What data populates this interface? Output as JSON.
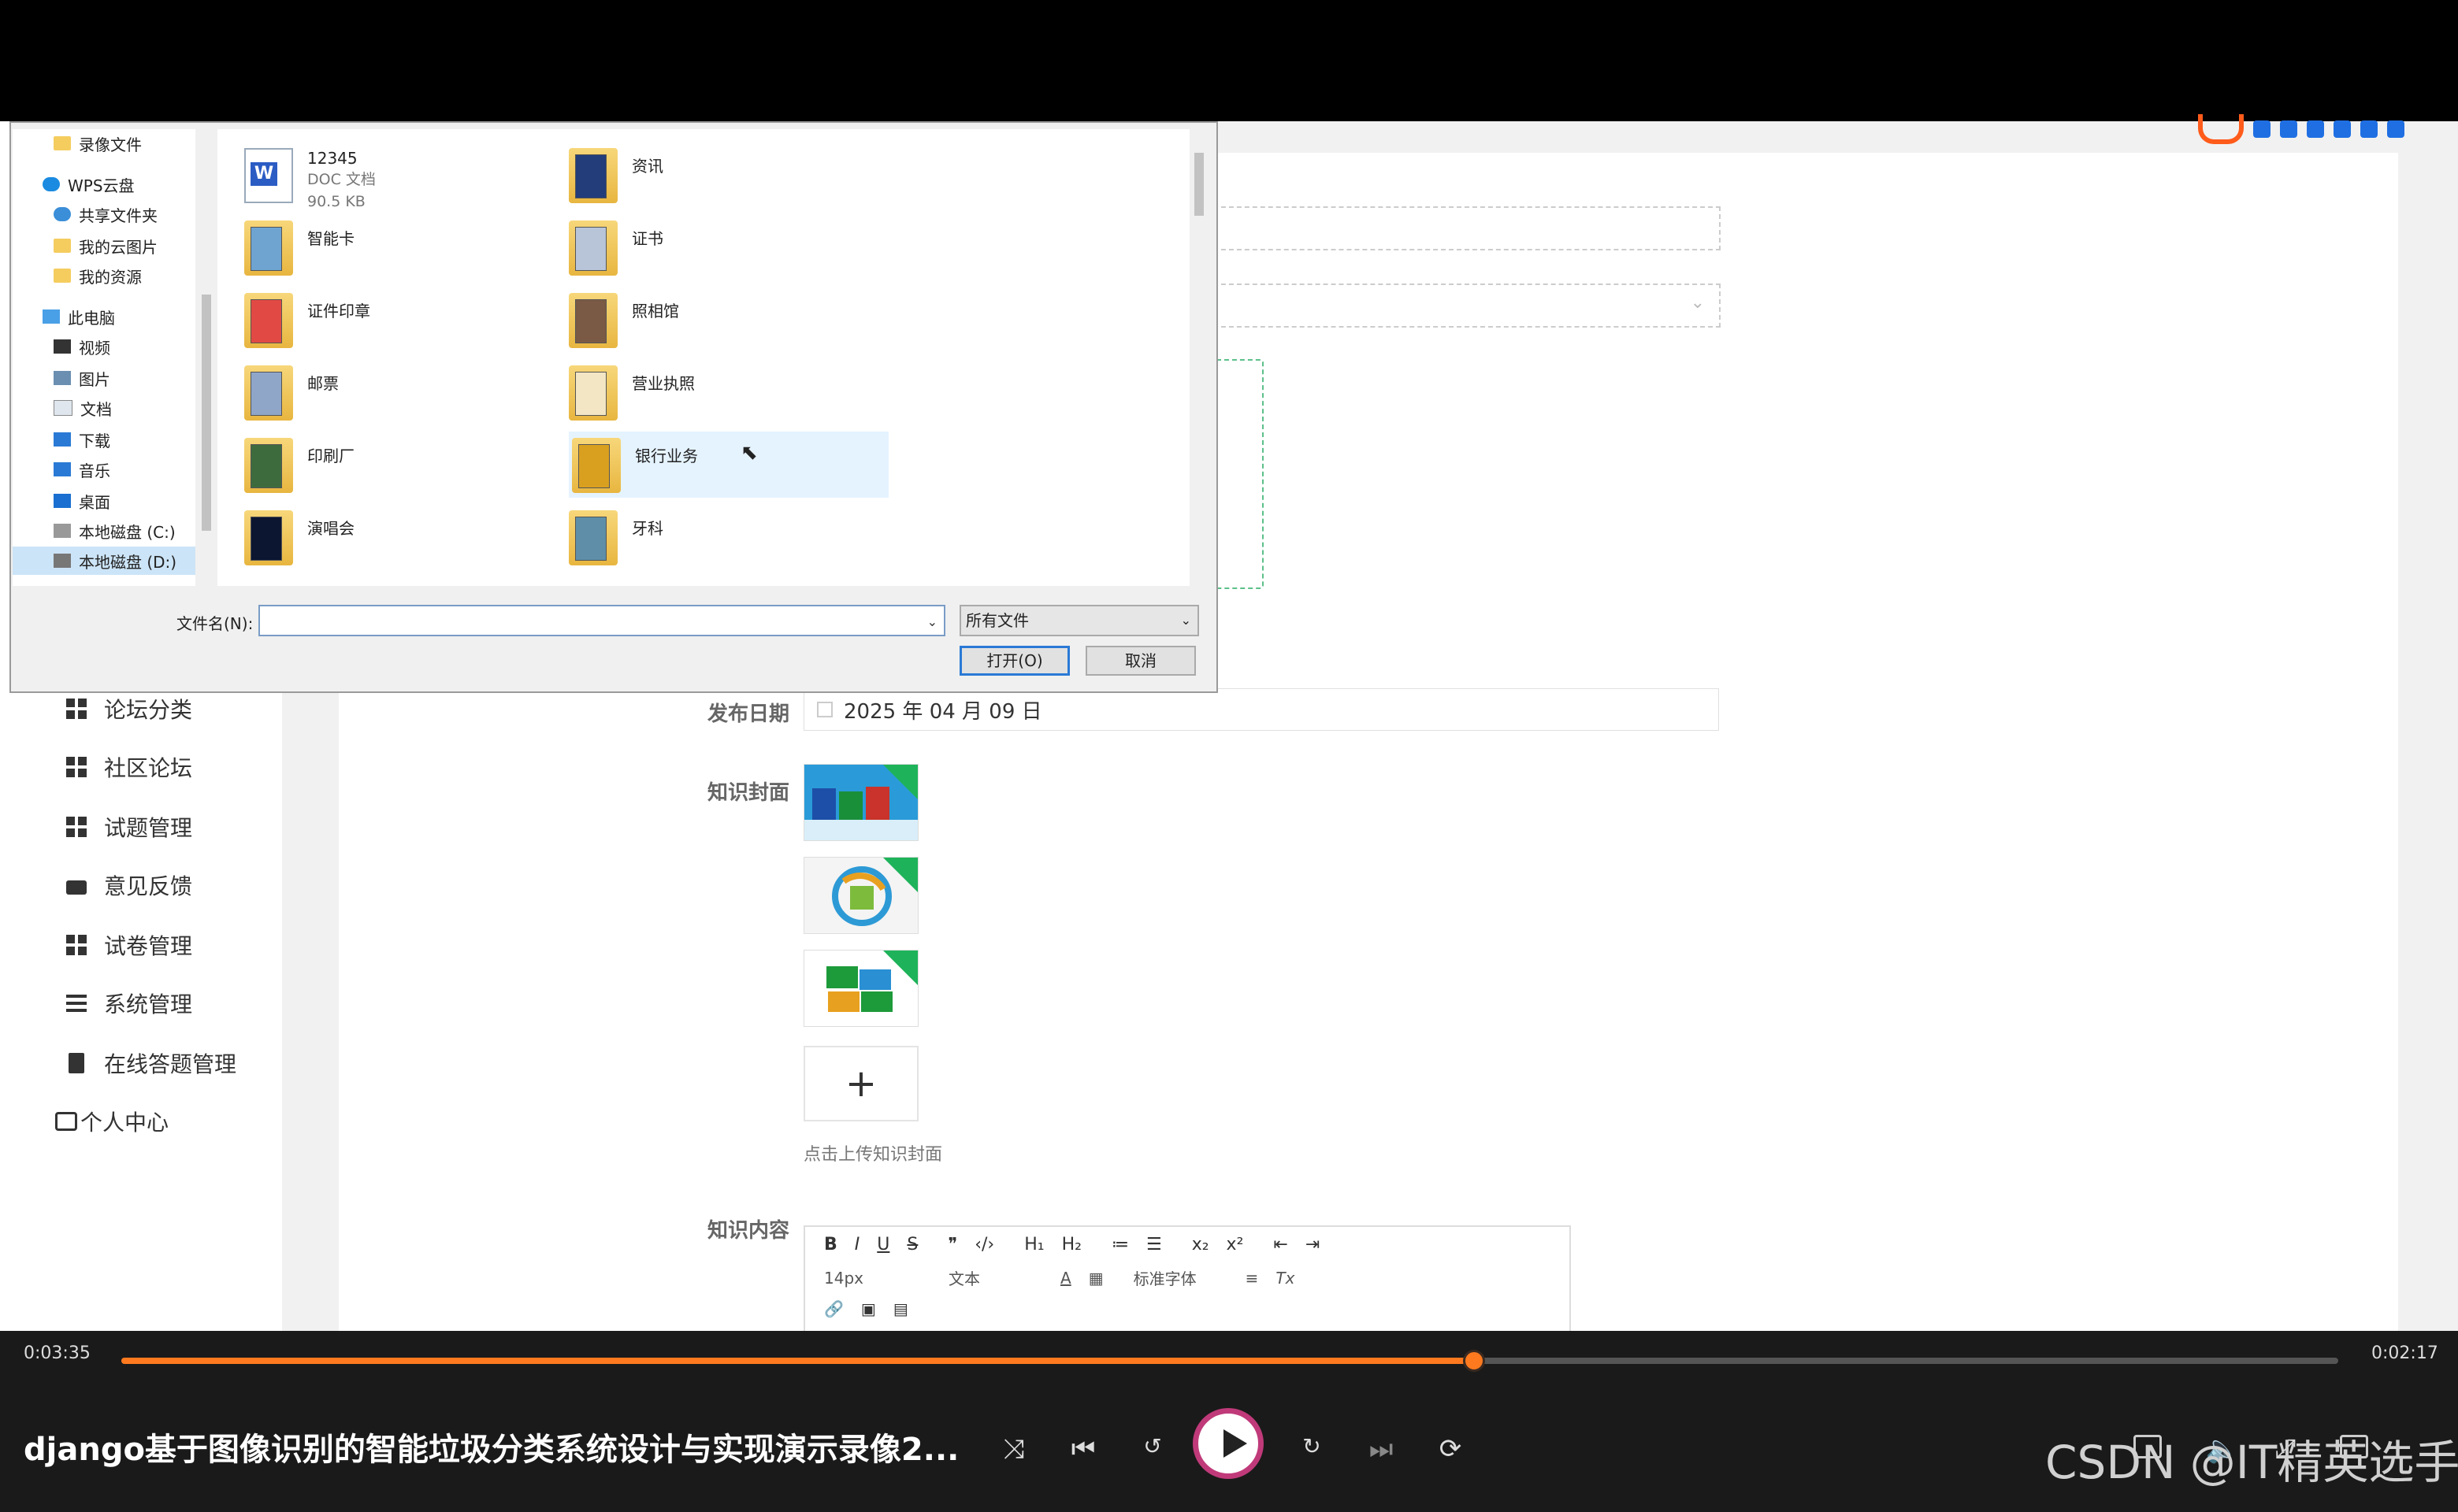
{
  "dialog": {
    "tree": [
      {
        "label": "录像文件",
        "icon": "folder-icon"
      },
      {
        "label": "WPS云盘",
        "icon": "cloud-icon"
      },
      {
        "label": "共享文件夹",
        "icon": "share-icon"
      },
      {
        "label": "我的云图片",
        "icon": "folder-icon"
      },
      {
        "label": "我的资源",
        "icon": "folder-icon"
      },
      {
        "label": "此电脑",
        "icon": "computer-icon"
      },
      {
        "label": "视频",
        "icon": "video-icon"
      },
      {
        "label": "图片",
        "icon": "picture-icon"
      },
      {
        "label": "文档",
        "icon": "document-icon"
      },
      {
        "label": "下载",
        "icon": "download-icon"
      },
      {
        "label": "音乐",
        "icon": "music-icon"
      },
      {
        "label": "桌面",
        "icon": "desktop-icon"
      },
      {
        "label": "本地磁盘 (C:)",
        "icon": "drive-icon"
      },
      {
        "label": "本地磁盘 (D:)",
        "icon": "drive-icon"
      }
    ],
    "files": [
      {
        "name": "12345",
        "type": "DOC 文档",
        "size": "90.5 KB",
        "icon": "word-doc-icon"
      },
      {
        "name": "资讯",
        "icon": "folder-icon"
      },
      {
        "name": "智能卡",
        "icon": "folder-icon"
      },
      {
        "name": "证书",
        "icon": "folder-icon"
      },
      {
        "name": "证件印章",
        "icon": "folder-icon"
      },
      {
        "name": "照相馆",
        "icon": "folder-icon"
      },
      {
        "name": "邮票",
        "icon": "folder-icon"
      },
      {
        "name": "营业执照",
        "icon": "folder-icon"
      },
      {
        "name": "印刷厂",
        "icon": "folder-icon"
      },
      {
        "name": "银行业务",
        "icon": "folder-icon"
      },
      {
        "name": "演唱会",
        "icon": "folder-icon"
      },
      {
        "name": "牙科",
        "icon": "folder-icon"
      }
    ],
    "filename_label": "文件名(N):",
    "filename_value": "",
    "filetype": "所有文件",
    "open_button": "打开(O)",
    "cancel_button": "取消"
  },
  "sidebar": {
    "items": [
      {
        "label": "论坛分类",
        "icon": "grid-icon"
      },
      {
        "label": "社区论坛",
        "icon": "grid-icon"
      },
      {
        "label": "试题管理",
        "icon": "grid-icon"
      },
      {
        "label": "意见反馈",
        "icon": "briefcase-icon"
      },
      {
        "label": "试卷管理",
        "icon": "grid-icon"
      },
      {
        "label": "系统管理",
        "icon": "list-icon"
      },
      {
        "label": "在线答题管理",
        "icon": "clipboard-icon"
      },
      {
        "label": "个人中心",
        "icon": "user-card-icon"
      }
    ]
  },
  "form": {
    "date_label": "发布日期",
    "date_value": "2025 年 04 月 09 日",
    "cover_label": "知识封面",
    "upload_plus": "+",
    "upload_hint": "点击上传知识封面",
    "content_label": "知识内容",
    "editor_toolbar": {
      "bold": "B",
      "italic": "I",
      "underline": "U",
      "strike": "S",
      "quote": "❞",
      "code": "‹/›",
      "h1": "H₁",
      "h2": "H₂",
      "ordered_list": "≔",
      "bullet_list": "☰",
      "subscript": "x₂",
      "superscript": "x²",
      "outdent": "⇤",
      "indent": "⇥",
      "font_size": "14px",
      "block_type": "文本",
      "font_color": "A",
      "background_color": "▦",
      "font_family": "标准字体",
      "align": "≡",
      "clear_format": "Tx",
      "link": "🔗",
      "image": "▣",
      "video": "▤"
    }
  },
  "player": {
    "current_time": "0:03:35",
    "remaining_time": "0:02:17",
    "progress": 0.61,
    "title": "django基于图像识别的智能垃圾分类系统设计与实现演示录像2...",
    "accent": "#ff7a1f"
  },
  "watermark": "CSDN @IT精英选手"
}
